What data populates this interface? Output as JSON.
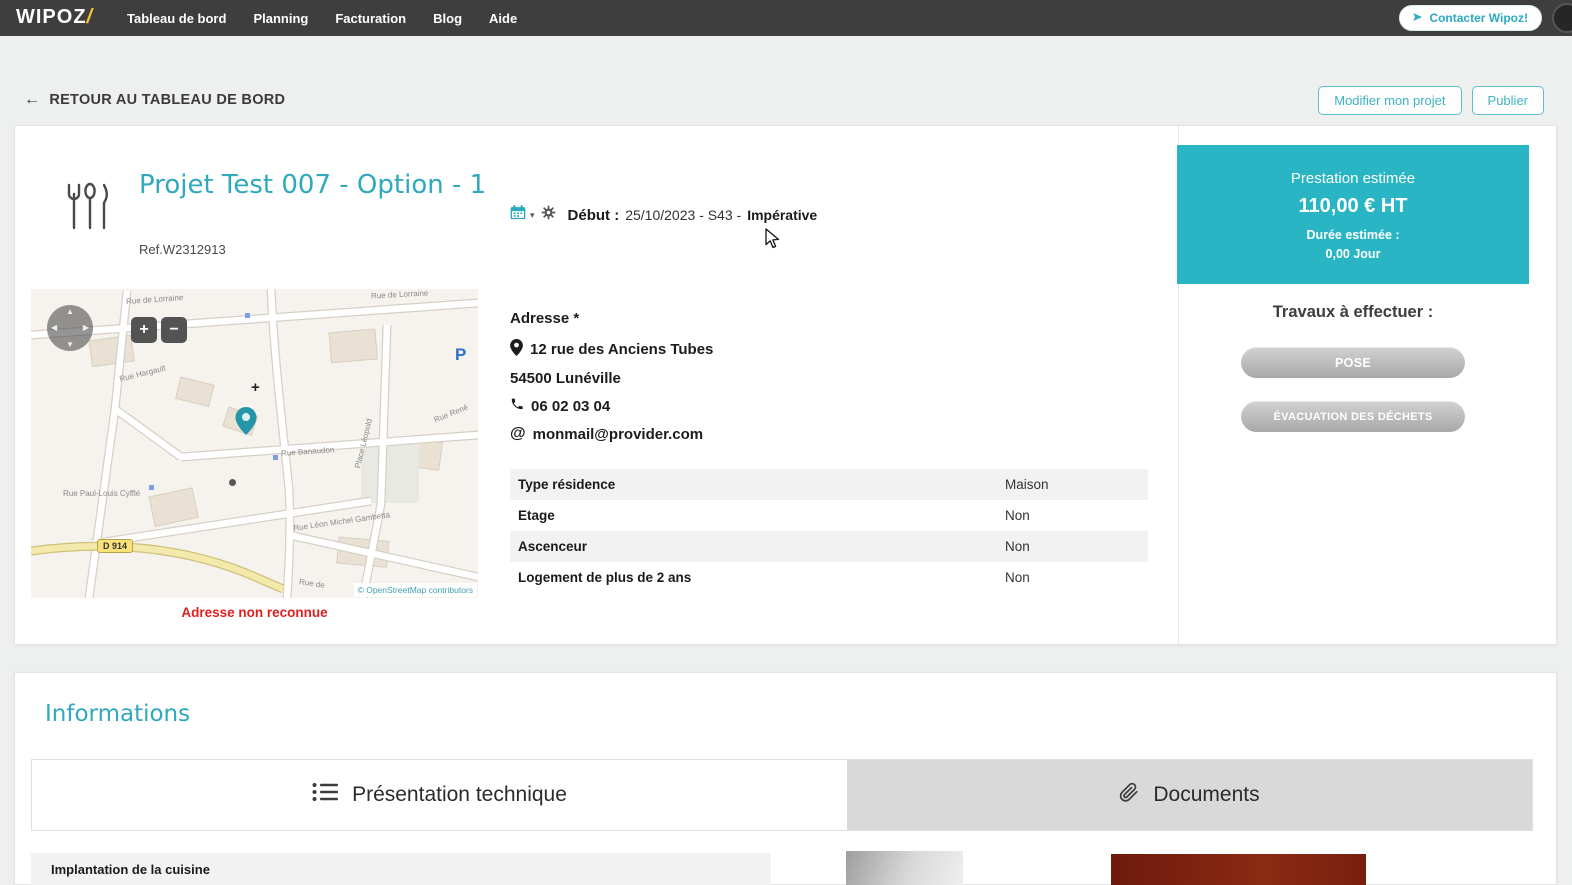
{
  "navbar": {
    "logo": "WIPOZ",
    "logo_accent": "/",
    "items": [
      "Tableau de bord",
      "Planning",
      "Facturation",
      "Blog",
      "Aide"
    ],
    "contact_button": "Contacter Wipoz!"
  },
  "toolbar": {
    "back_arrow": "←",
    "back_label": "RETOUR AU TABLEAU DE BORD",
    "modify_button": "Modifier mon projet",
    "publish_button": "Publier"
  },
  "project": {
    "title": "Projet Test 007 - Option - 1",
    "reference": "Ref.W2312913",
    "calendar_caret": "▾",
    "start_label": "Début :",
    "start_value": "25/10/2023 - S43 -",
    "start_flag": "Impérative",
    "address": {
      "heading": "Adresse *",
      "line1": "12 rue des Anciens Tubes",
      "line2": "54500 Lunéville",
      "phone": "06 02 03 04",
      "email_symbol": "@",
      "email": "monmail@provider.com"
    },
    "details": [
      {
        "label": "Type résidence",
        "value": "Maison"
      },
      {
        "label": "Etage",
        "value": "Non"
      },
      {
        "label": "Ascenceur",
        "value": "Non"
      },
      {
        "label": "Logement de plus de 2 ans",
        "value": "Non"
      }
    ]
  },
  "map": {
    "error": "Adresse non reconnue",
    "attribution": "© OpenStreetMap contributors",
    "road_badge": "D 914",
    "parking_symbol": "P",
    "poi_cross": "+",
    "zoom_in": "+",
    "zoom_out": "−",
    "pan_up": "▲",
    "pan_down": "▼",
    "pan_left": "◀",
    "pan_right": "▶",
    "labels": [
      "Rue de Lorraine",
      "Rue de Lorraine",
      "Rue Hargault",
      "Rue Banaudon",
      "Place Léopold",
      "Rue Léon Michel Gambetta",
      "Rue Paul-Louis Cyfflé",
      "Rue René",
      "Rue de"
    ]
  },
  "estimate": {
    "title": "Prestation estimée",
    "amount": "110,00 € HT",
    "duration_label": "Durée estimée :",
    "duration_value": "0,00 Jour"
  },
  "works": {
    "heading": "Travaux à effectuer :",
    "items": [
      "POSE",
      "ÉVACUATION DES DÉCHETS"
    ]
  },
  "informations": {
    "title": "Informations",
    "tabs": [
      "Présentation technique",
      "Documents"
    ],
    "row": "Implantation de la cuisine"
  },
  "colors": {
    "accent_teal": "#29b5c3",
    "navbar_bg": "#3e3e3e",
    "error_red": "#e01f1f",
    "logo_slash_yellow": "#f2c230"
  }
}
